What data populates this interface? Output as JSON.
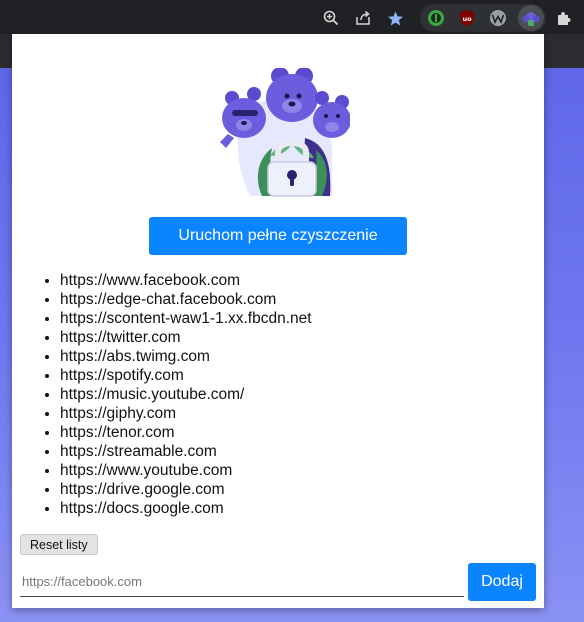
{
  "toolbar": {
    "icons": [
      "zoom-icon",
      "share-icon",
      "bookmark-star-icon"
    ],
    "extensions": [
      "ext-green-icon",
      "ublock-icon",
      "ext-w-icon",
      "cleaner-extension-icon",
      "extensions-puzzle-icon"
    ],
    "accent_star_color": "#8ab4f8"
  },
  "popup": {
    "run_button_label": "Uruchom pełne czyszczenie",
    "urls": [
      "https://www.facebook.com",
      "https://edge-chat.facebook.com",
      "https://scontent-waw1-1.xx.fbcdn.net",
      "https://twitter.com",
      "https://abs.twimg.com",
      "https://spotify.com",
      "https://music.youtube.com/",
      "https://giphy.com",
      "https://tenor.com",
      "https://streamable.com",
      "https://www.youtube.com",
      "https://drive.google.com",
      "https://docs.google.com"
    ],
    "reset_button_label": "Reset listy",
    "input_placeholder": "https://facebook.com",
    "add_button_label": "Dodaj",
    "accent_color": "#0a84ff"
  }
}
